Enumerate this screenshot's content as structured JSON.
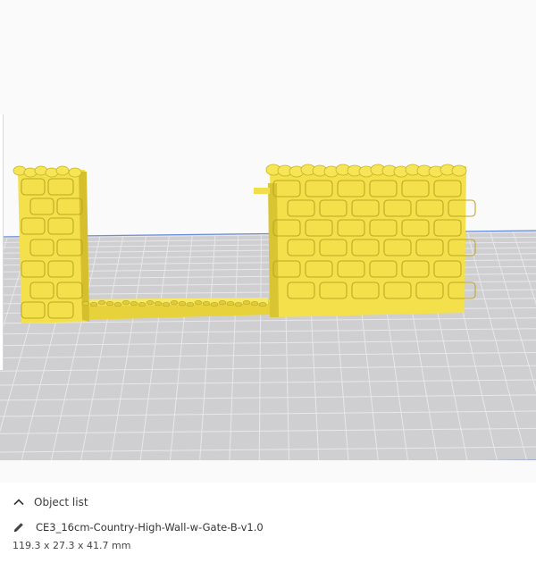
{
  "viewport": {
    "build_plate_color": "#c9c9cc",
    "grid_color": "#e6e6e8",
    "plate_edge_color": "#6b8fd6",
    "model_color": "#f5e24a",
    "model_shadow_color": "#c9b522"
  },
  "object_list": {
    "header_label": "Object list",
    "collapse_icon": "chevron-up-icon",
    "edit_icon": "pencil-icon",
    "object_name": "CE3_16cm-Country-High-Wall-w-Gate-B-v1.0",
    "dimensions": "119.3 x 27.3 x 41.7 mm"
  }
}
